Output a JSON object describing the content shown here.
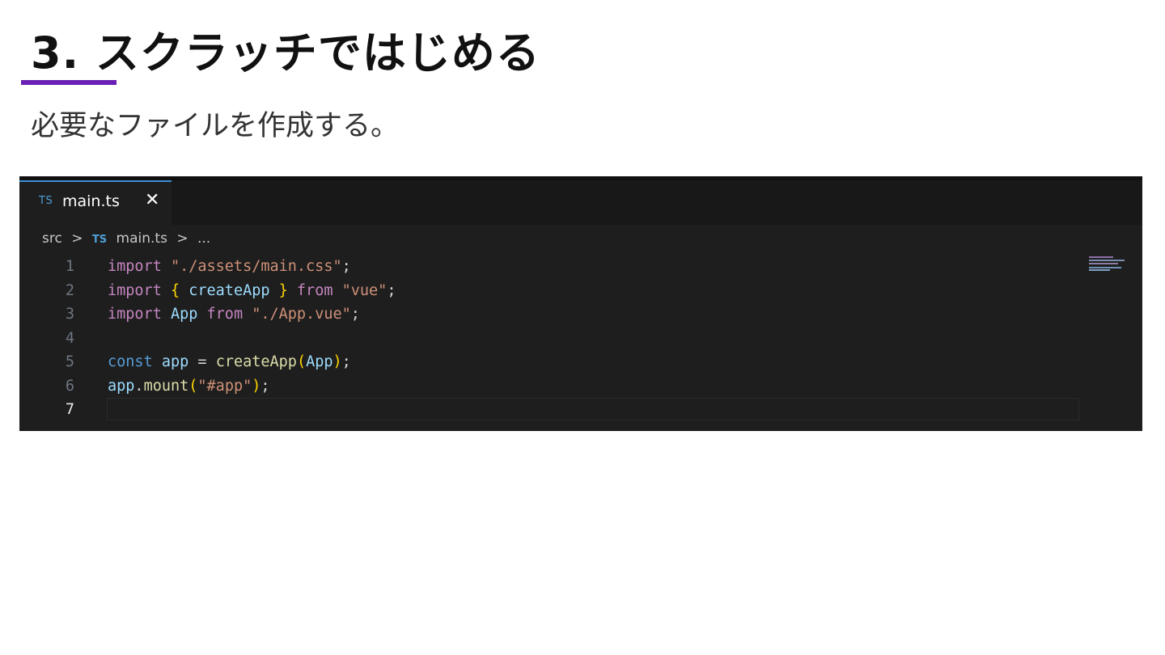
{
  "slide": {
    "title": "3. スクラッチではじめる",
    "subtitle": "必要なファイルを作成する。",
    "accent_color": "#6a1fb5"
  },
  "editor": {
    "tab": {
      "icon": "TS",
      "label": "main.ts",
      "close": "✕"
    },
    "breadcrumb": {
      "folder": "src",
      "sep1": ">",
      "file_icon": "TS",
      "file": "main.ts",
      "sep2": ">",
      "more": "..."
    },
    "active_line": 7,
    "lines": [
      {
        "num": "1",
        "tokens": [
          [
            "kw",
            "import"
          ],
          [
            "punc",
            " "
          ],
          [
            "str",
            "\"./assets/main.css\""
          ],
          [
            "punc",
            ";"
          ]
        ]
      },
      {
        "num": "2",
        "tokens": [
          [
            "kw",
            "import"
          ],
          [
            "punc",
            " "
          ],
          [
            "br1",
            "{"
          ],
          [
            "punc",
            " "
          ],
          [
            "var",
            "createApp"
          ],
          [
            "punc",
            " "
          ],
          [
            "br1",
            "}"
          ],
          [
            "punc",
            " "
          ],
          [
            "kw",
            "from"
          ],
          [
            "punc",
            " "
          ],
          [
            "str",
            "\"vue\""
          ],
          [
            "punc",
            ";"
          ]
        ]
      },
      {
        "num": "3",
        "tokens": [
          [
            "kw",
            "import"
          ],
          [
            "punc",
            " "
          ],
          [
            "var",
            "App"
          ],
          [
            "punc",
            " "
          ],
          [
            "kw",
            "from"
          ],
          [
            "punc",
            " "
          ],
          [
            "str",
            "\"./App.vue\""
          ],
          [
            "punc",
            ";"
          ]
        ]
      },
      {
        "num": "4",
        "tokens": []
      },
      {
        "num": "5",
        "tokens": [
          [
            "kw2",
            "const"
          ],
          [
            "punc",
            " "
          ],
          [
            "var",
            "app"
          ],
          [
            "punc",
            " = "
          ],
          [
            "fn",
            "createApp"
          ],
          [
            "br1",
            "("
          ],
          [
            "var",
            "App"
          ],
          [
            "br1",
            ")"
          ],
          [
            "punc",
            ";"
          ]
        ]
      },
      {
        "num": "6",
        "tokens": [
          [
            "var",
            "app"
          ],
          [
            "punc",
            "."
          ],
          [
            "fn",
            "mount"
          ],
          [
            "br1",
            "("
          ],
          [
            "str",
            "\"#app\""
          ],
          [
            "br1",
            ")"
          ],
          [
            "punc",
            ";"
          ]
        ]
      },
      {
        "num": "7",
        "tokens": []
      }
    ],
    "colors": {
      "background": "#1e1e1e",
      "tab_accent": "#3c8fd8",
      "keyword": "#c586c0",
      "storage": "#569cd6",
      "string": "#ce9178",
      "variable": "#9cdcfe",
      "function": "#dcdcaa"
    }
  }
}
